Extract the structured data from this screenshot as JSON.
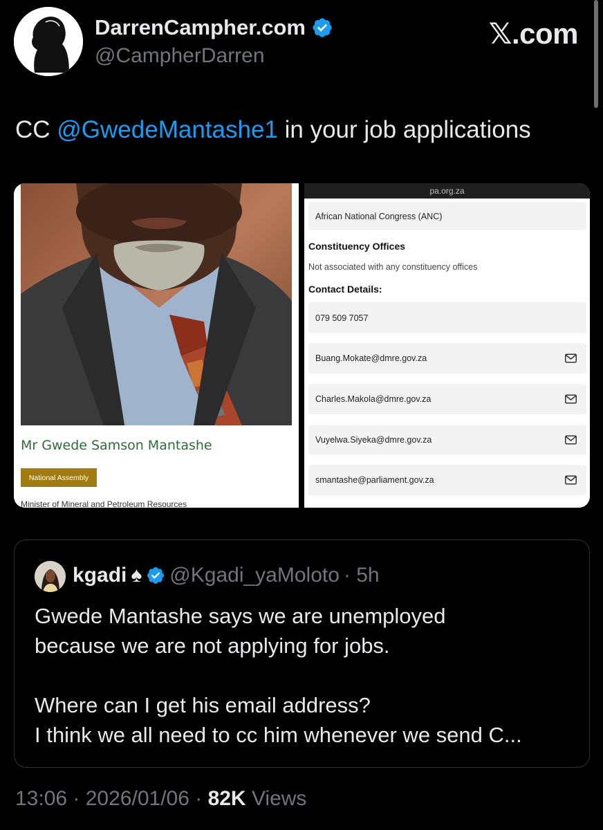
{
  "author": {
    "name": "DarrenCampher.com",
    "handle": "@CampherDarren"
  },
  "brand": "𝕏.com",
  "tweet": {
    "prefix": "CC ",
    "mention": "@GwedeMantashe1",
    "suffix": " in your job applications"
  },
  "media_left": {
    "name": "Mr Gwede Samson Mantashe",
    "badge": "National Assembly",
    "title": "Minister of Mineral and Petroleum Resources"
  },
  "media_right": {
    "url": "pa.org.za",
    "party": "African National Congress (ANC)",
    "constituency_heading": "Constituency Offices",
    "constituency_text": "Not associated with any constituency offices",
    "contact_heading": "Contact Details:",
    "phone": "079 509 7057",
    "emails": [
      "Buang.Mokate@dmre.gov.za",
      "Charles.Makola@dmre.gov.za",
      "Vuyelwa.Siyeka@dmre.gov.za",
      "smantashe@parliament.gov.za"
    ]
  },
  "quote": {
    "name": "kgadi",
    "name_emoji": "♠",
    "handle": "@Kgadi_yaMoloto",
    "age": "· 5h",
    "text": "Gwede Mantashe says we are unemployed\nbecause we are not applying for jobs.\n\nWhere can I get his email address?\nI think we all need to cc him whenever we send C..."
  },
  "meta": {
    "time": "13:06",
    "date": "· 2026/01/06 ·",
    "views_count": "82K",
    "views_label": "Views"
  },
  "colors": {
    "background": "#000000",
    "link": "#1d9bf0",
    "verified": "#1d9bf0",
    "muted": "#71767b"
  }
}
